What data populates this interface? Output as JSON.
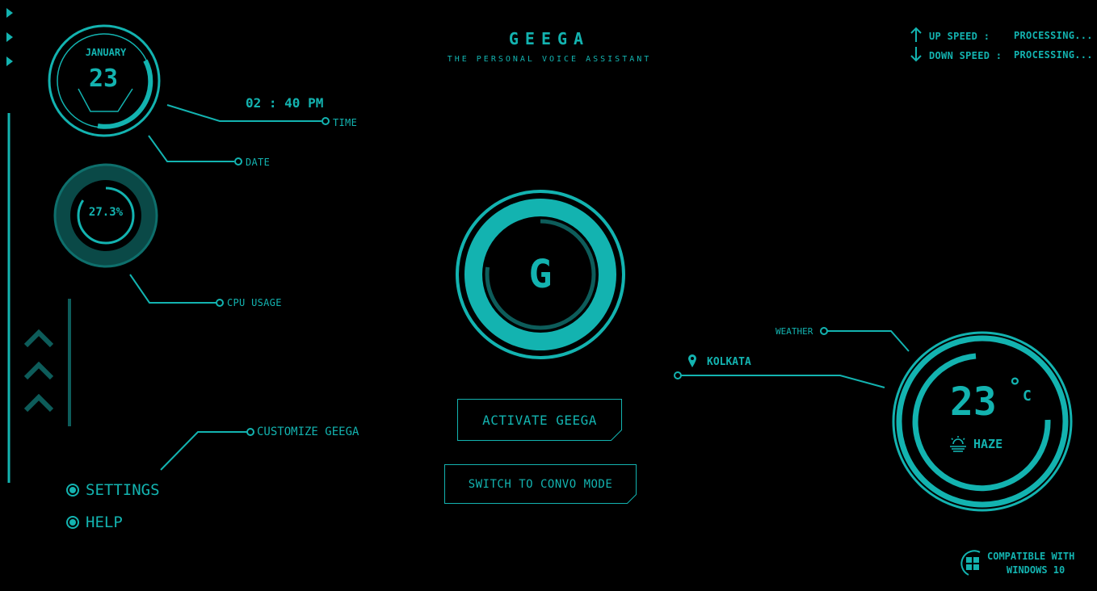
{
  "app": {
    "title": "GEEGA",
    "subtitle": "THE PERSONAL VOICE ASSISTANT",
    "accent": "#13b3b0",
    "dark_accent": "#0d5c5a",
    "background": "#000000"
  },
  "network": {
    "up_label": "UP SPEED :",
    "up_value": "PROCESSING...",
    "down_label": "DOWN SPEED :",
    "down_value": "PROCESSING..."
  },
  "date_widget": {
    "month": "JANUARY",
    "day": "23",
    "label": "DATE"
  },
  "time_widget": {
    "time": "02 : 40 PM",
    "label": "TIME"
  },
  "cpu_widget": {
    "value": "27.3%",
    "percent": 27.3,
    "label": "CPU USAGE"
  },
  "core": {
    "letter": "G"
  },
  "buttons": {
    "activate": "ACTIVATE GEEGA",
    "switch_mode": "SWITCH TO CONVO MODE"
  },
  "menu": {
    "customize": "CUSTOMIZE GEEGA",
    "settings": "SETTINGS",
    "help": "HELP"
  },
  "weather": {
    "label": "WEATHER",
    "location": "KOLKATA",
    "temp": "23",
    "degree": "°",
    "unit": "C",
    "condition": "HAZE"
  },
  "footer": {
    "line1": "COMPATIBLE WITH",
    "line2": "WINDOWS 10"
  },
  "icons": [
    "triangle-nav-icon",
    "chevron-up-icon",
    "arrow-up-icon",
    "arrow-down-icon",
    "map-pin-icon",
    "haze-icon",
    "windows-icon"
  ]
}
